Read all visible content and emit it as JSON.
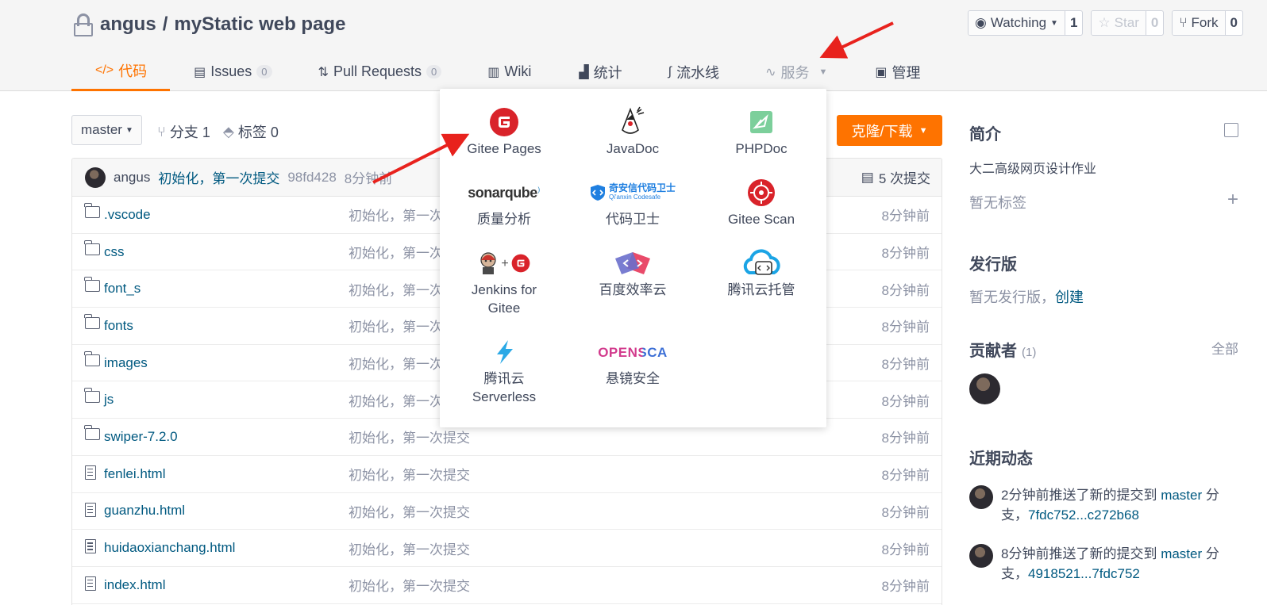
{
  "repo": {
    "owner": "angus",
    "separator": "/",
    "name": "myStatic web page"
  },
  "actions": {
    "watch": {
      "label": "Watching",
      "count": "1"
    },
    "star": {
      "label": "Star",
      "count": "0"
    },
    "fork": {
      "label": "Fork",
      "count": "0"
    }
  },
  "tabs": [
    {
      "label": "代码",
      "icon": "code-icon"
    },
    {
      "label": "Issues",
      "badge": "0",
      "icon": "issues-icon"
    },
    {
      "label": "Pull Requests",
      "badge": "0",
      "icon": "pull-request-icon"
    },
    {
      "label": "Wiki",
      "icon": "book-icon"
    },
    {
      "label": "统计",
      "icon": "bar-chart-icon"
    },
    {
      "label": "流水线",
      "icon": "pipeline-icon"
    },
    {
      "label": "服务",
      "icon": "pulse-icon"
    },
    {
      "label": "管理",
      "icon": "manage-icon"
    }
  ],
  "toolbar": {
    "branch": "master",
    "branches": "分支 1",
    "tags": "标签 0",
    "clone": "克隆/下载"
  },
  "commit": {
    "author": "angus",
    "message": "初始化，第一次提交",
    "sha": "98fd428",
    "time": "8分钟前",
    "count": "5 次提交"
  },
  "files": [
    {
      "name": ".vscode",
      "type": "folder",
      "message": "初始化，第一次提交",
      "time": "8分钟前"
    },
    {
      "name": "css",
      "type": "folder",
      "message": "初始化，第一次提交",
      "time": "8分钟前"
    },
    {
      "name": "font_s",
      "type": "folder",
      "message": "初始化，第一次提交",
      "time": "8分钟前"
    },
    {
      "name": "fonts",
      "type": "folder",
      "message": "初始化，第一次提交",
      "time": "8分钟前"
    },
    {
      "name": "images",
      "type": "folder",
      "message": "初始化，第一次提交",
      "time": "8分钟前"
    },
    {
      "name": "js",
      "type": "folder",
      "message": "初始化，第一次提交",
      "time": "8分钟前"
    },
    {
      "name": "swiper-7.2.0",
      "type": "folder",
      "message": "初始化，第一次提交",
      "time": "8分钟前"
    },
    {
      "name": "fenlei.html",
      "type": "file",
      "message": "初始化，第一次提交",
      "time": "8分钟前"
    },
    {
      "name": "guanzhu.html",
      "type": "file",
      "message": "初始化，第一次提交",
      "time": "8分钟前"
    },
    {
      "name": "huidaoxianchang.html",
      "type": "file",
      "message": "初始化，第一次提交",
      "time": "8分钟前"
    },
    {
      "name": "index.html",
      "type": "file",
      "message": "初始化，第一次提交",
      "time": "8分钟前"
    }
  ],
  "sidebar": {
    "intro_title": "简介",
    "intro_text": "大二高级网页设计作业",
    "no_tags": "暂无标签",
    "release_title": "发行版",
    "no_release": "暂无发行版，",
    "create": "创建",
    "contributors_title": "贡献者",
    "contributors_count": "(1)",
    "all": "全部",
    "activity_title": "近期动态",
    "activities": [
      {
        "prefix": "2分钟前推送了新的提交到 ",
        "branch": "master",
        "suffix": " 分支，",
        "range": "7fdc752...c272b68"
      },
      {
        "prefix": "8分钟前推送了新的提交到 ",
        "branch": "master",
        "suffix": " 分支，",
        "range": "4918521...7fdc752"
      }
    ]
  },
  "services": [
    {
      "name": "Gitee Pages",
      "logo": "gitee-logo"
    },
    {
      "name": "JavaDoc",
      "logo": "javadoc-duke-logo"
    },
    {
      "name": "PHPDoc",
      "logo": "phpdoc-logo"
    },
    {
      "name": "质量分析",
      "logo": "sonarqube-logo",
      "logo_text": "sonarqube"
    },
    {
      "name": "代码卫士",
      "logo": "qianxin-codesafe-logo",
      "logo_text": "奇安信代码卫士",
      "logo_sub": "Qi'anxin Codesafe"
    },
    {
      "name": "Gitee Scan",
      "logo": "gitee-scan-logo"
    },
    {
      "name": "Jenkins for Gitee",
      "logo": "jenkins-gitee-logo"
    },
    {
      "name": "百度效率云",
      "logo": "baidu-efficiency-logo"
    },
    {
      "name": "腾讯云托管",
      "logo": "tencent-cloud-hosting-logo"
    },
    {
      "name": "腾讯云 Serverless",
      "logo": "tencent-serverless-logo"
    },
    {
      "name": "悬镜安全",
      "logo": "opensca-logo",
      "logo_text": "OPENSCA"
    }
  ],
  "colors": {
    "accent": "#fe7300",
    "link": "#005980",
    "arrow": "#e8221d"
  }
}
